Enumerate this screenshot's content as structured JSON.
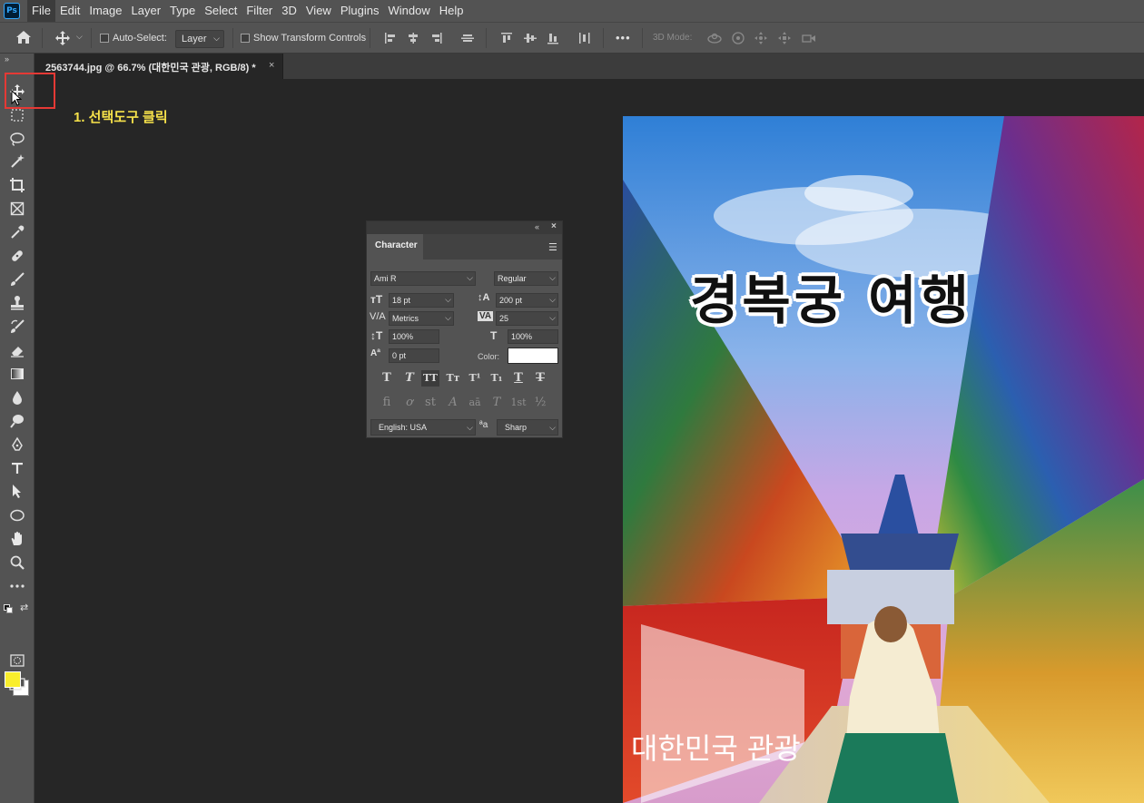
{
  "app": {
    "logo": "Ps"
  },
  "menu": [
    "File",
    "Edit",
    "Image",
    "Layer",
    "Type",
    "Select",
    "Filter",
    "3D",
    "View",
    "Plugins",
    "Window",
    "Help"
  ],
  "options_bar": {
    "auto_select_label": "Auto-Select:",
    "layer_select": "Layer",
    "show_transform_label": "Show Transform Controls",
    "more": "•••",
    "mode_3d_label": "3D Mode:"
  },
  "document_tab": {
    "title": "2563744.jpg @ 66.7% (대한민국 관광, RGB/8) *",
    "close": "×"
  },
  "annotation": "1. 선택도구 클릭",
  "canvas": {
    "title_text": "경복궁 여행",
    "subtitle_text": "대한민국 관광"
  },
  "character_panel": {
    "tab_label": "Character",
    "font_family": "Ami R",
    "font_style": "Regular",
    "font_size": "18 pt",
    "leading": "200 pt",
    "kerning": "Metrics",
    "tracking": "25",
    "vertical_scale": "100%",
    "horizontal_scale": "100%",
    "baseline_shift": "0 pt",
    "color_label": "Color:",
    "color_value": "#ffffff",
    "language": "English: USA",
    "antialias": "Sharp",
    "type_buttons": [
      "T",
      "T",
      "TT",
      "Tт",
      "T¹",
      "T₁",
      "T",
      "T"
    ],
    "opentype_buttons": [
      "fi",
      "ơ",
      "st",
      "A",
      "aā",
      "T",
      "1st",
      "½"
    ]
  },
  "colors": {
    "foreground": "#f9ee2d",
    "background": "#ffffff",
    "annotation": "#f7e24a",
    "highlight": "#e53935"
  }
}
